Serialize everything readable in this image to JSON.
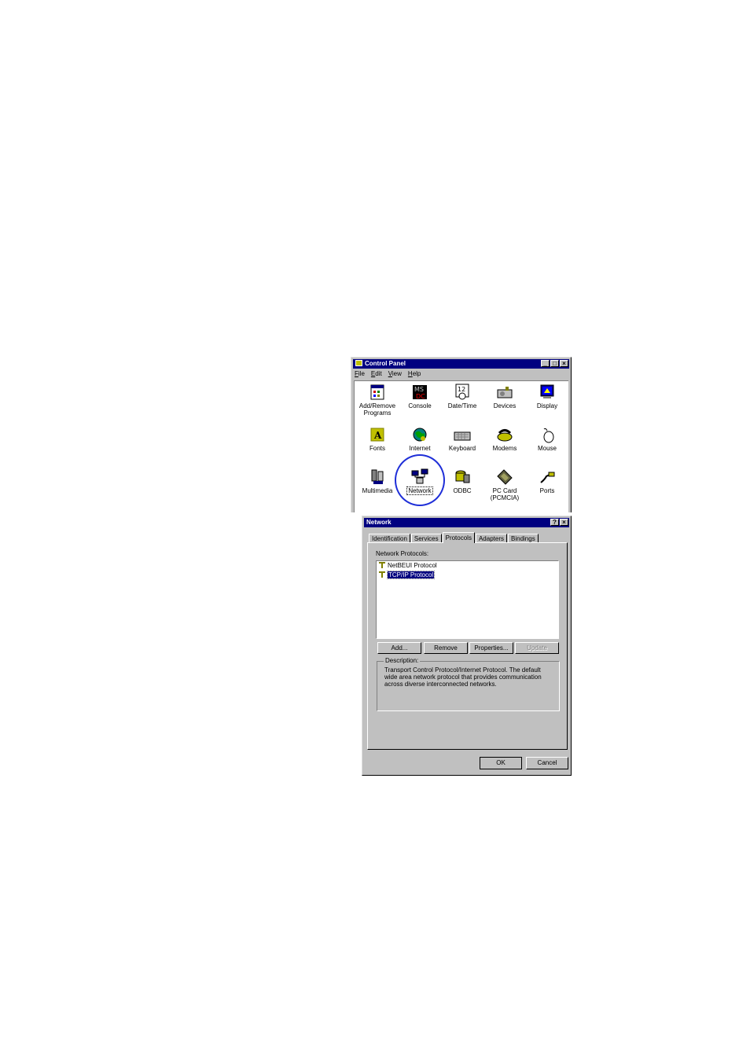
{
  "control_panel": {
    "title": "Control Panel",
    "menu": [
      {
        "label": "File",
        "mnemonic": "F",
        "rest": "ile"
      },
      {
        "label": "Edit",
        "mnemonic": "E",
        "rest": "dit"
      },
      {
        "label": "View",
        "mnemonic": "V",
        "rest": "iew"
      },
      {
        "label": "Help",
        "mnemonic": "H",
        "rest": "elp"
      }
    ],
    "items": [
      {
        "label": "Add/Remove Programs",
        "icon": "add-remove-programs-icon"
      },
      {
        "label": "Console",
        "icon": "console-icon"
      },
      {
        "label": "Date/Time",
        "icon": "date-time-icon"
      },
      {
        "label": "Devices",
        "icon": "devices-icon"
      },
      {
        "label": "Display",
        "icon": "display-icon"
      },
      {
        "label": "Fonts",
        "icon": "fonts-icon"
      },
      {
        "label": "Internet",
        "icon": "internet-icon"
      },
      {
        "label": "Keyboard",
        "icon": "keyboard-icon"
      },
      {
        "label": "Modems",
        "icon": "modems-icon"
      },
      {
        "label": "Mouse",
        "icon": "mouse-icon"
      },
      {
        "label": "Multimedia",
        "icon": "multimedia-icon"
      },
      {
        "label": "Network",
        "icon": "network-icon"
      },
      {
        "label": "ODBC",
        "icon": "odbc-icon"
      },
      {
        "label": "PC Card (PCMCIA)",
        "icon": "pc-card-icon"
      },
      {
        "label": "Ports",
        "icon": "ports-icon"
      }
    ],
    "highlight_color": "#1f2fd8"
  },
  "network_dialog": {
    "title": "Network",
    "tabs": [
      "Identification",
      "Services",
      "Protocols",
      "Adapters",
      "Bindings"
    ],
    "active_tab": "Protocols",
    "list_label": "Network Protocols:",
    "protocols": [
      {
        "label": "NetBEUI Protocol",
        "selected": false
      },
      {
        "label": "TCP/IP Protocol",
        "selected": true
      }
    ],
    "buttons": {
      "add": "Add...",
      "remove": "Remove",
      "properties": "Properties...",
      "update": "Update"
    },
    "description_title": "Description:",
    "description": "Transport Control Protocol/Internet Protocol. The default wide area network protocol that provides communication across diverse interconnected networks.",
    "ok": "OK",
    "cancel": "Cancel"
  }
}
